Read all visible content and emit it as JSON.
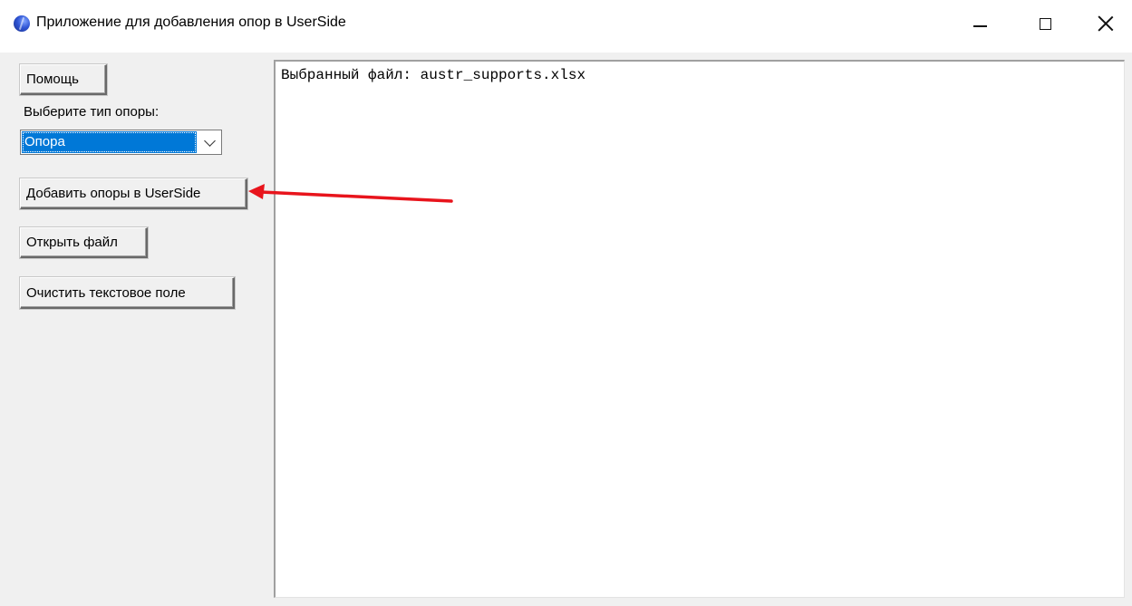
{
  "window": {
    "title": "Приложение для добавления опор в UserSide",
    "controls": {
      "minimize_icon": "minimize-icon",
      "maximize_icon": "maximize-icon",
      "close_icon": "close-icon"
    }
  },
  "left_panel": {
    "help_button": "Помощь",
    "type_label": "Выберите тип опоры:",
    "type_select": {
      "selected": "Опора"
    },
    "add_button": "Добавить опоры в UserSide",
    "open_button": "Открыть файл",
    "clear_button": "Очистить текстовое поле"
  },
  "output": {
    "text": "Выбранный файл: austr_supports.xlsx"
  },
  "colors": {
    "selection": "#0078d7",
    "annotation": "#e8141c",
    "window_bg": "#f0f0f0"
  }
}
